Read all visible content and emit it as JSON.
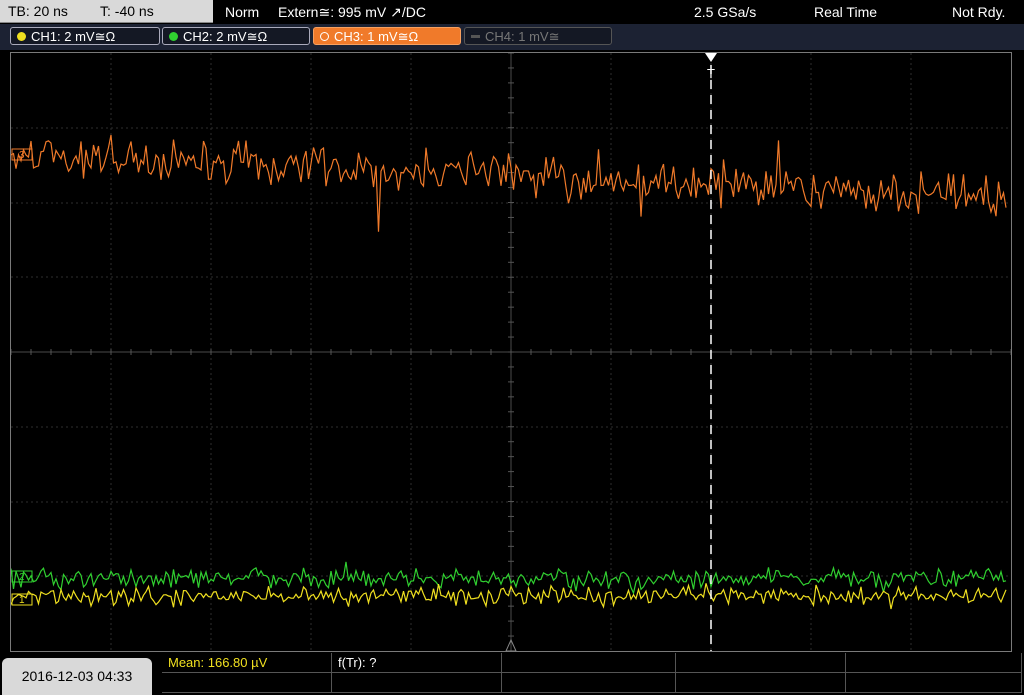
{
  "top": {
    "timebase": "TB: 20 ns",
    "trigger_time": "T: -40 ns",
    "mode": "Norm",
    "trigger": "Extern≅: 995 mV ↗/DC",
    "sample_rate": "2.5 GSa/s",
    "acq_mode": "Real Time",
    "state": "Not Rdy."
  },
  "channels": [
    {
      "label": "CH1: 2 mV≅Ω",
      "color": "#f0e020",
      "state": "on"
    },
    {
      "label": "CH2: 2 mV≅Ω",
      "color": "#30d030",
      "state": "on"
    },
    {
      "label": "CH3: 1 mV≅Ω",
      "color": "#f07a2a",
      "state": "selected"
    },
    {
      "label": "CH4: 1 mV≅",
      "color": "#666666",
      "state": "off"
    }
  ],
  "markers": {
    "ch3": "3",
    "ch2": "2",
    "ch1": "1",
    "trigger": "T"
  },
  "bottom": {
    "datetime": "2016-12-03 04:33",
    "measure1": "Mean: 166.80 µV",
    "measure2": "f(Tr): ?"
  },
  "colors": {
    "ch1": "#f0e020",
    "ch2": "#30d030",
    "ch3": "#f07a2a",
    "grid": "#3a3a3a",
    "trigger_line": "#ffffff"
  }
}
